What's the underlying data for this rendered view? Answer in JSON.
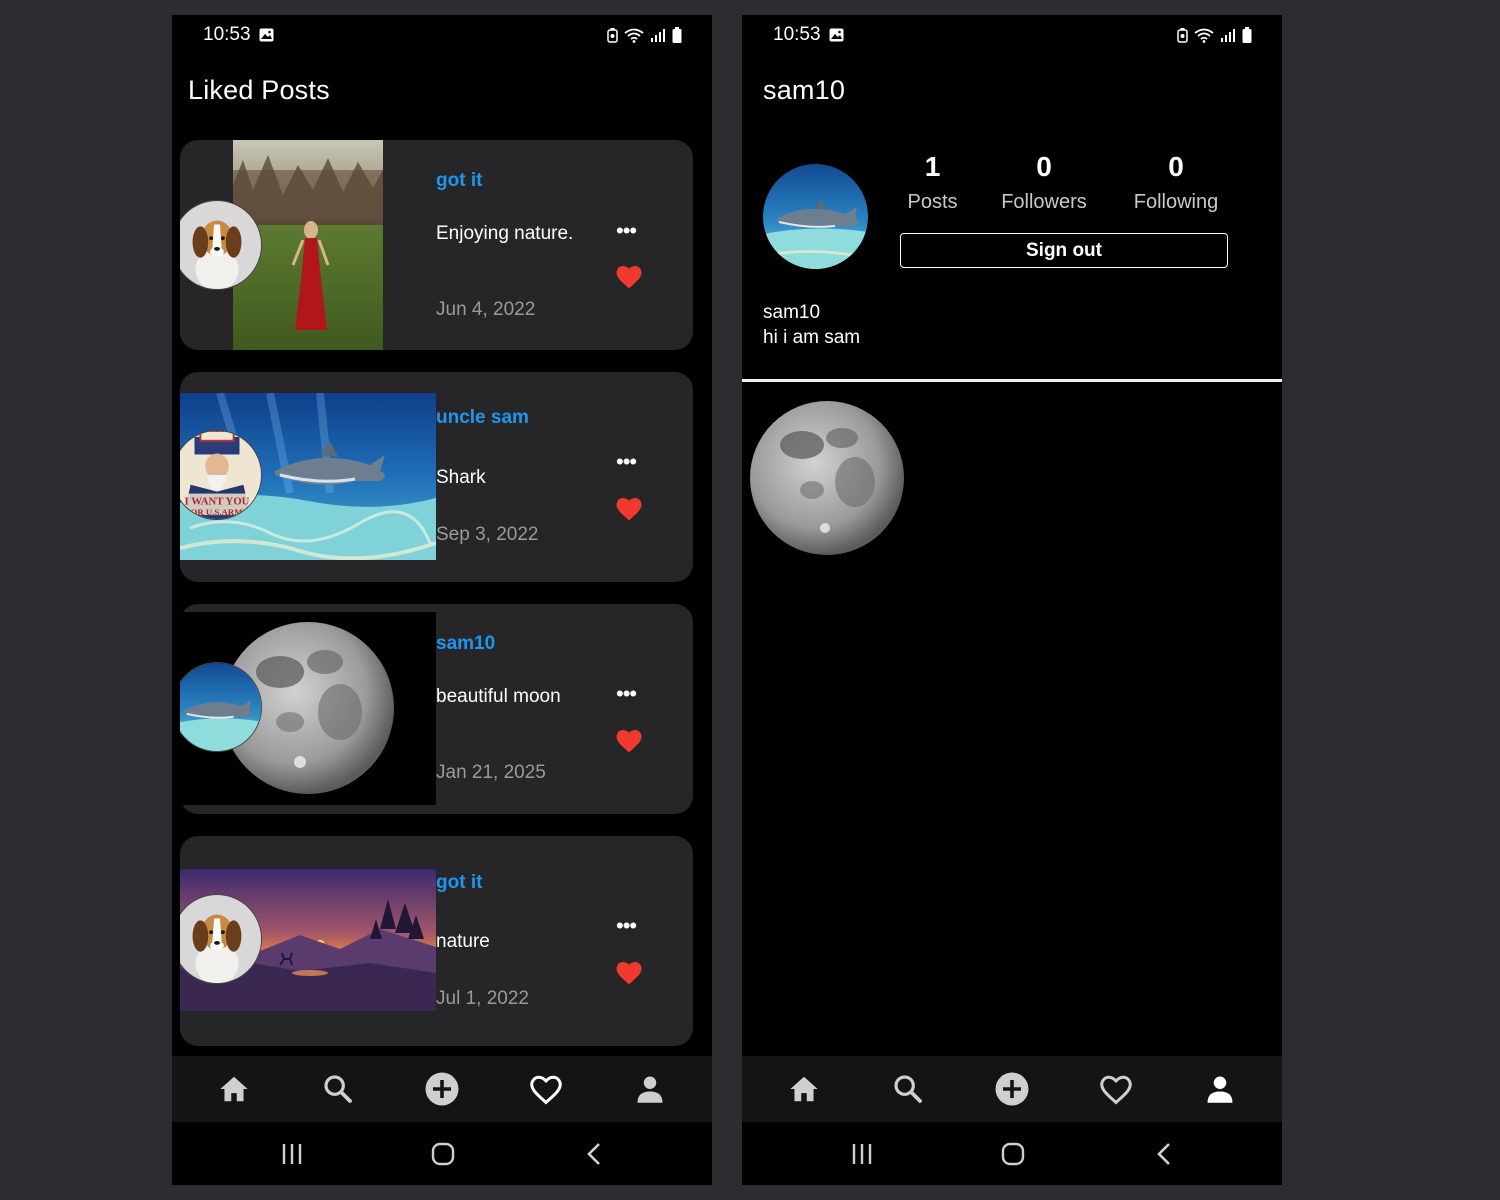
{
  "left_screen": {
    "status": {
      "time": "10:53"
    },
    "title": "Liked Posts",
    "posts": [
      {
        "user": "got it",
        "caption": "Enjoying nature.",
        "date": "Jun 4, 2022",
        "liked": true,
        "image": "woman-in-red-dress-field",
        "avatar": "beagle-puppy"
      },
      {
        "user": "uncle sam",
        "caption": "Shark",
        "date": "Sep 3, 2022",
        "liked": true,
        "image": "shark-underwater",
        "avatar": "uncle-sam-poster"
      },
      {
        "user": "sam10",
        "caption": "beautiful moon",
        "date": "Jan 21, 2025",
        "liked": true,
        "image": "full-moon",
        "avatar": "shark-underwater"
      },
      {
        "user": "got it",
        "caption": "nature",
        "date": "Jul 1, 2022",
        "liked": true,
        "image": "sunset-mountains-deer",
        "avatar": "beagle-puppy"
      }
    ],
    "more_glyph": "•••",
    "active_tab": "likes"
  },
  "right_screen": {
    "status": {
      "time": "10:53"
    },
    "title": "sam10",
    "stats": {
      "posts": {
        "value": "1",
        "label": "Posts"
      },
      "followers": {
        "value": "0",
        "label": "Followers"
      },
      "following": {
        "value": "0",
        "label": "Following"
      }
    },
    "sign_out_label": "Sign out",
    "username": "sam10",
    "bio": "hi i am sam",
    "active_tab": "profile"
  },
  "nav_icons": [
    "home-icon",
    "search-icon",
    "add-post-icon",
    "heart-icon",
    "profile-icon"
  ],
  "colors": {
    "background": "#2b2d31",
    "screen": "#000000",
    "card": "#262628",
    "username_blue": "#1e96f0",
    "heart_red": "#f03a2e",
    "date_gray": "#9a9a9a"
  }
}
